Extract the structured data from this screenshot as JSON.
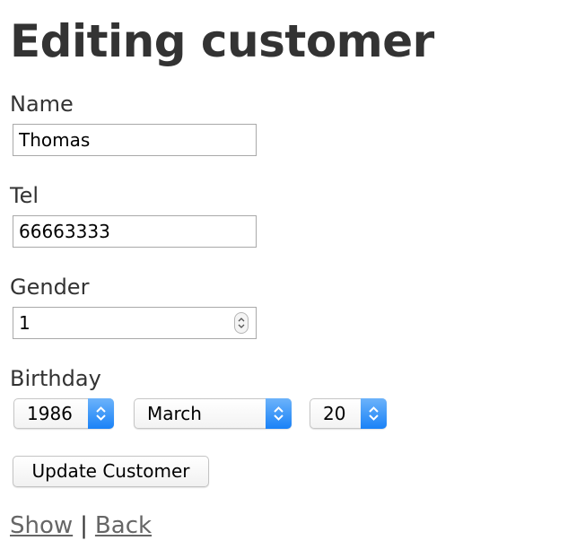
{
  "page": {
    "title": "Editing customer"
  },
  "form": {
    "name": {
      "label": "Name",
      "value": "Thomas"
    },
    "tel": {
      "label": "Tel",
      "value": "66663333"
    },
    "gender": {
      "label": "Gender",
      "value": "1"
    },
    "birthday": {
      "label": "Birthday",
      "year": "1986",
      "month": "March",
      "day": "20"
    },
    "submit_label": "Update Customer"
  },
  "links": {
    "show": "Show",
    "separator": "|",
    "back": "Back"
  },
  "colors": {
    "text": "#333333",
    "link": "#666666",
    "select_accent": "#1a82f7"
  },
  "icons": {
    "spinner": "up-down-stepper-icon",
    "select_arrow": "up-down-chevron-icon"
  }
}
